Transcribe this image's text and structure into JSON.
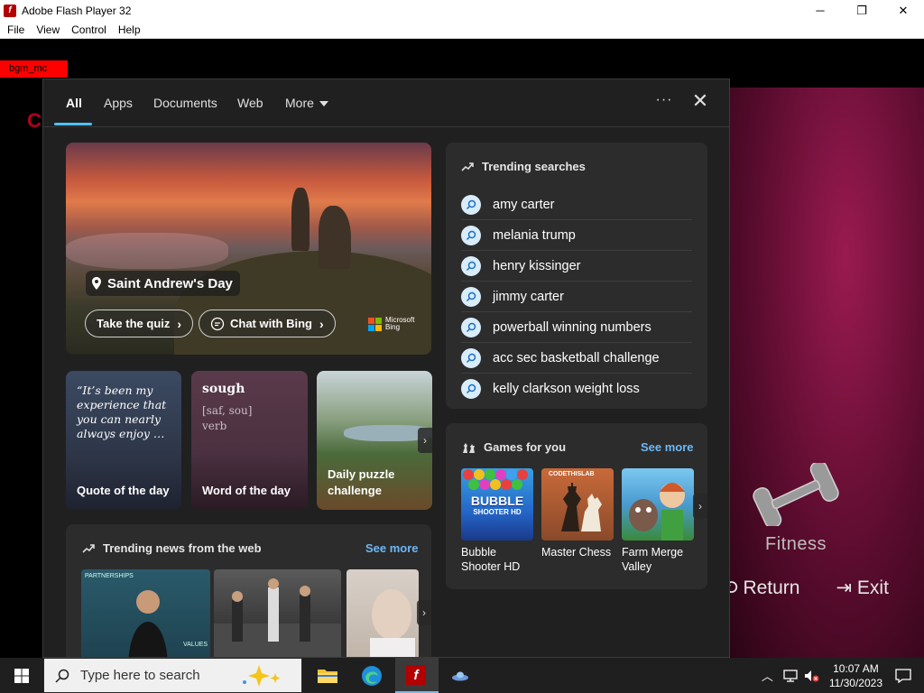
{
  "window": {
    "title": "Adobe Flash Player 32",
    "controls": {
      "minimize": "─",
      "maximize": "❐",
      "close": "✕"
    },
    "menu": [
      "File",
      "View",
      "Control",
      "Help"
    ]
  },
  "stage": {
    "bgm_tag": "bgm_mc",
    "partial_letter": "C",
    "fitness_label": "Fitness",
    "return_label": "Return",
    "exit_label": "Exit"
  },
  "search_panel": {
    "tabs": [
      "All",
      "Apps",
      "Documents",
      "Web",
      "More"
    ],
    "active_tab": "All",
    "hero": {
      "location": "Saint Andrew's Day",
      "quiz_button": "Take the quiz",
      "chat_button": "Chat with Bing",
      "brand_line1": "Microsoft",
      "brand_line2": "Bing"
    },
    "cards": {
      "quote_text": "“It’s been my experience that you can nearly always enjoy …",
      "quote_caption": "Quote of the day",
      "word": "sough",
      "word_phonetic": "[saf, sou]",
      "word_pos": "verb",
      "word_caption": "Word of the day",
      "puzzle_caption_1": "Daily puzzle",
      "puzzle_caption_2": "challenge"
    },
    "trending_searches": {
      "title": "Trending searches",
      "items": [
        "amy carter",
        "melania trump",
        "henry kissinger",
        "jimmy carter",
        "powerball winning numbers",
        "acc sec basketball challenge",
        "kelly clarkson weight loss"
      ]
    },
    "games": {
      "title": "Games for you",
      "see_more": "See more",
      "items": [
        {
          "line1": "Bubble",
          "line2": "Shooter HD",
          "art_text": "BUBBLE",
          "art_sub": "SHOOTER HD"
        },
        {
          "line1": "Master Chess",
          "line2": "",
          "art_text": "CODETHISLAB"
        },
        {
          "line1": "Farm Merge",
          "line2": "Valley"
        }
      ]
    },
    "news": {
      "title": "Trending news from the web",
      "see_more": "See more",
      "banner_text_1": "PARTNERSHIPS",
      "banner_text_2": "VALUES"
    }
  },
  "taskbar": {
    "search_placeholder": "Type here to search",
    "time": "10:07 AM",
    "date": "11/30/2023"
  },
  "colors": {
    "accent": "#4cc2ff",
    "link": "#6cb8f6",
    "panel_bg": "#202020",
    "card_bg": "#2c2c2c",
    "flash_red": "#b30000"
  }
}
